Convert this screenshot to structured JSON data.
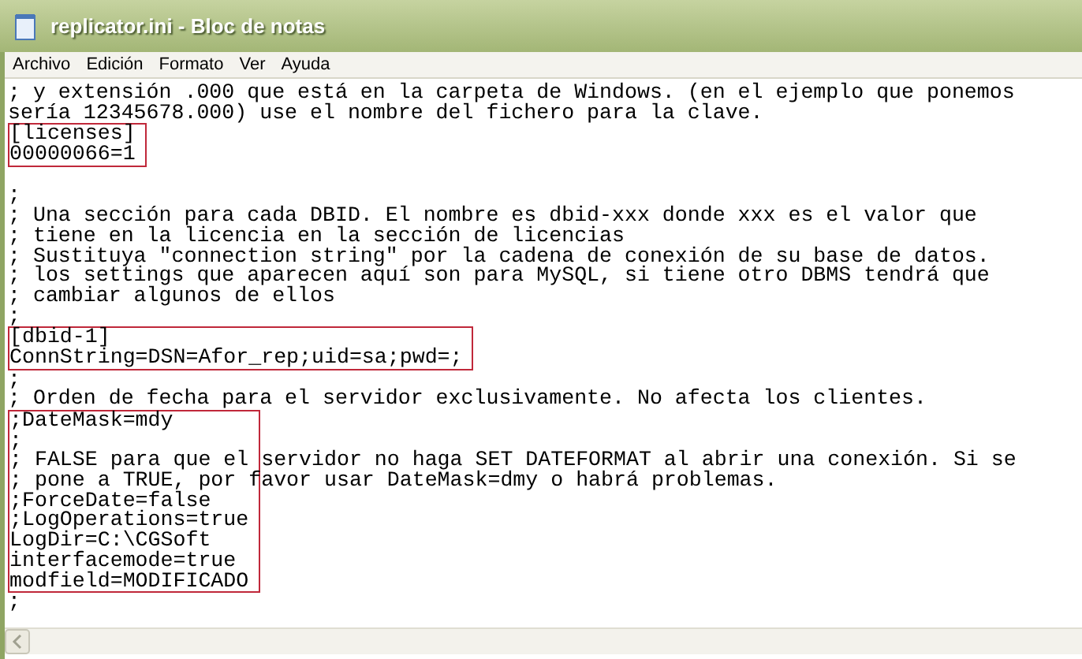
{
  "window": {
    "title": "replicator.ini - Bloc de notas"
  },
  "menu": [
    "Archivo",
    "Edición",
    "Formato",
    "Ver",
    "Ayuda"
  ],
  "editor": {
    "blocks": [
      {
        "highlighted": false,
        "lines": [
          "; y extensión .000 que está en la carpeta de Windows. (en el ejemplo que ponemos",
          "sería 12345678.000) use el nombre del fichero para la clave."
        ]
      },
      {
        "highlighted": true,
        "lines": [
          "[licenses]",
          "00000066=1"
        ]
      },
      {
        "highlighted": false,
        "blank_line_before": true,
        "lines": [
          ";",
          "; Una sección para cada DBID. El nombre es dbid-xxx donde xxx es el valor que",
          "; tiene en la licencia en la sección de licencias",
          "; Sustituya \"connection string\" por la cadena de conexión de su base de datos.",
          "; los settings que aparecen aquí son para MySQL, si tiene otro DBMS tendrá que",
          "; cambiar algunos de ellos",
          ";"
        ]
      },
      {
        "highlighted": true,
        "lines": [
          "[dbid-1]",
          "ConnString=DSN=Afor_rep;uid=sa;pwd=;"
        ]
      },
      {
        "highlighted": false,
        "lines": [
          ";",
          "; Orden de fecha para el servidor exclusivamente. No afecta los clientes."
        ]
      },
      {
        "highlighted": true,
        "lines": [
          ";DateMask=mdy",
          ";",
          "; FALSE para que el servidor no haga SET DATEFORMAT al abrir una conexión. Si se",
          "; pone a TRUE, por favor usar DateMask=dmy o habrá problemas.",
          ";ForceDate=false",
          ";LogOperations=true",
          "LogDir=C:\\CGSoft",
          "interfacemode=true",
          "modfield=MODIFICADO"
        ]
      },
      {
        "highlighted": false,
        "lines": [
          ";"
        ]
      }
    ]
  }
}
